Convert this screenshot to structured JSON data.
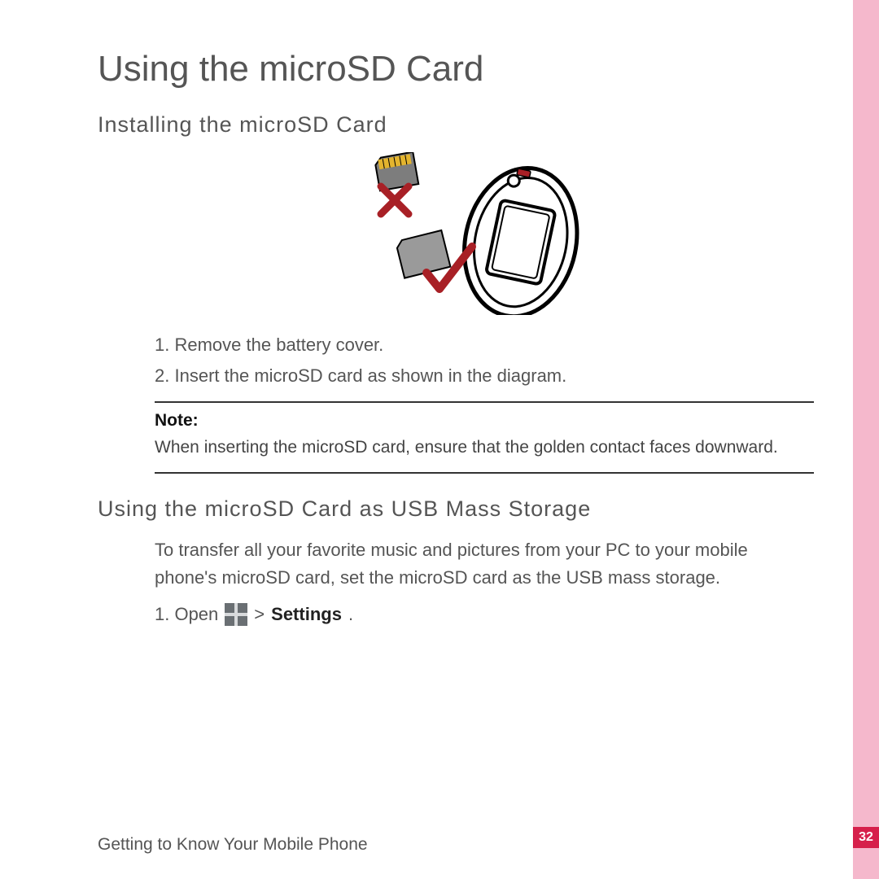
{
  "heading": "Using the microSD Card",
  "section1": {
    "title": "Installing the microSD Card",
    "step1_num": "1.",
    "step1_text": "Remove the battery cover.",
    "step2_num": "2.",
    "step2_text": "Insert the microSD card as shown in the diagram."
  },
  "note": {
    "label": "Note:",
    "text": "When inserting the microSD card, ensure that the golden contact faces downward."
  },
  "section2": {
    "title": "Using the microSD Card as USB Mass Storage",
    "intro": "To transfer all your favorite music and pictures from your PC to your mobile phone's microSD card, set the microSD card as the USB mass storage.",
    "step1_prefix": "1. Open",
    "step1_gt": ">",
    "step1_settings": "Settings",
    "step1_dot": "."
  },
  "footer": "Getting to Know Your Mobile Phone",
  "page_number": "32"
}
